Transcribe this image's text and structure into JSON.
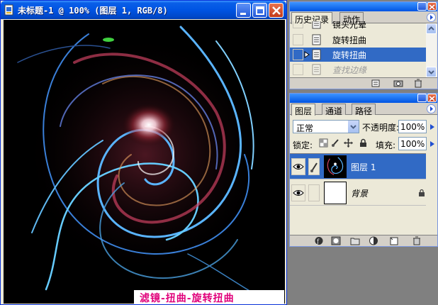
{
  "document": {
    "title": "未标题-1 @ 100% (图层 1, RGB/8)",
    "caption": "滤镜-扭曲-旋转扭曲",
    "caption_color": "#e0007a"
  },
  "history_panel": {
    "tabs": [
      {
        "label": "历史记录",
        "active": true
      },
      {
        "label": "动作",
        "active": false
      }
    ],
    "items": [
      {
        "label": "镜头光晕",
        "state": "normal"
      },
      {
        "label": "旋转扭曲",
        "state": "normal"
      },
      {
        "label": "旋转扭曲",
        "state": "selected"
      },
      {
        "label": "查找边缘",
        "state": "disabled"
      }
    ]
  },
  "layers_panel": {
    "tabs": [
      {
        "label": "图层",
        "active": true
      },
      {
        "label": "通道",
        "active": false
      },
      {
        "label": "路径",
        "active": false
      }
    ],
    "blend_mode": "正常",
    "opacity_label": "不透明度:",
    "opacity_value": "100%",
    "lock_label": "锁定:",
    "fill_label": "填充:",
    "fill_value": "100%",
    "layers": [
      {
        "name": "图层 1",
        "selected": true,
        "visible": true,
        "locked": false
      },
      {
        "name": "背景",
        "selected": false,
        "visible": true,
        "locked": true
      }
    ]
  },
  "colors": {
    "titlebar_blue": "#0054e3",
    "selection_blue": "#316ac5",
    "panel_bg": "#ece9d8",
    "workspace_gray": "#808080"
  }
}
